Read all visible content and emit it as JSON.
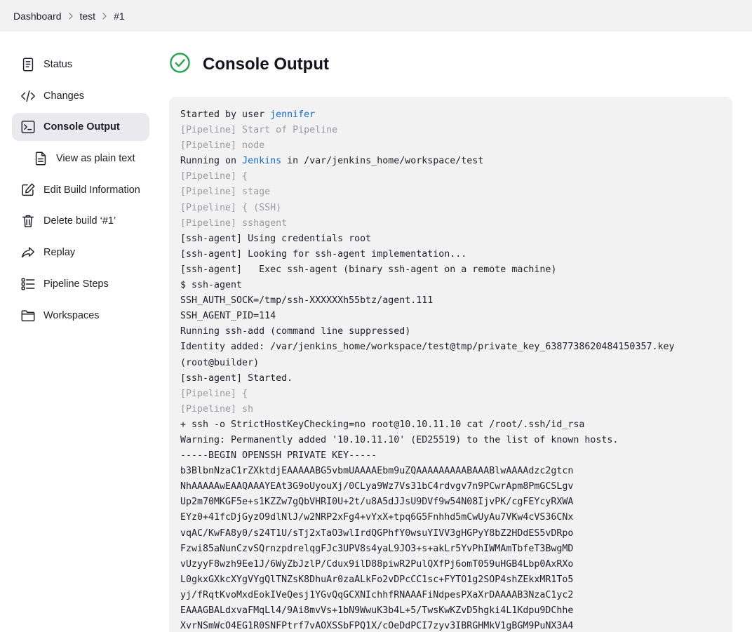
{
  "breadcrumb": [
    "Dashboard",
    "test",
    "#1"
  ],
  "sidebar": {
    "items": [
      {
        "label": "Status",
        "icon": "status-icon",
        "active": false
      },
      {
        "label": "Changes",
        "icon": "code-icon",
        "active": false
      },
      {
        "label": "Console Output",
        "icon": "terminal-icon",
        "active": true
      },
      {
        "label": "View as plain text",
        "icon": "document-icon",
        "active": false
      },
      {
        "label": "Edit Build Information",
        "icon": "edit-icon",
        "active": false
      },
      {
        "label": "Delete build ‘#1’",
        "icon": "trash-icon",
        "active": false
      },
      {
        "label": "Replay",
        "icon": "replay-icon",
        "active": false
      },
      {
        "label": "Pipeline Steps",
        "icon": "steps-icon",
        "active": false
      },
      {
        "label": "Workspaces",
        "icon": "folder-icon",
        "active": false
      }
    ]
  },
  "main": {
    "title": "Console Output",
    "status_icon": "success-check-icon",
    "status_color": "#1ea64b"
  },
  "console": {
    "started_prefix": "Started by user ",
    "started_user": "jennifer",
    "running_prefix": "Running on ",
    "running_node": "Jenkins",
    "running_suffix": " in /var/jenkins_home/workspace/test",
    "lines_a": [
      {
        "text": "[Pipeline] Start of Pipeline",
        "muted": true
      },
      {
        "text": "[Pipeline] node",
        "muted": true
      }
    ],
    "lines_b": [
      {
        "text": "[Pipeline] {",
        "muted": true
      },
      {
        "text": "[Pipeline] stage",
        "muted": true
      },
      {
        "text": "[Pipeline] { (SSH)",
        "muted": true
      },
      {
        "text": "[Pipeline] sshagent",
        "muted": true
      },
      {
        "text": "[ssh-agent] Using credentials root",
        "muted": false
      },
      {
        "text": "[ssh-agent] Looking for ssh-agent implementation...",
        "muted": false
      },
      {
        "text": "[ssh-agent]   Exec ssh-agent (binary ssh-agent on a remote machine)",
        "muted": false
      },
      {
        "text": "$ ssh-agent",
        "muted": false
      },
      {
        "text": "SSH_AUTH_SOCK=/tmp/ssh-XXXXXXh55btz/agent.111",
        "muted": false
      },
      {
        "text": "SSH_AGENT_PID=114",
        "muted": false
      },
      {
        "text": "Running ssh-add (command line suppressed)",
        "muted": false
      },
      {
        "text": "Identity added: /var/jenkins_home/workspace/test@tmp/private_key_6387738620484150357.key",
        "muted": false
      },
      {
        "text": "(root@builder)",
        "muted": false
      },
      {
        "text": "[ssh-agent] Started.",
        "muted": false
      },
      {
        "text": "[Pipeline] {",
        "muted": true
      },
      {
        "text": "[Pipeline] sh",
        "muted": true
      },
      {
        "text": "+ ssh -o StrictHostKeyChecking=no root@10.10.11.10 cat /root/.ssh/id_rsa",
        "muted": false
      },
      {
        "text": "Warning: Permanently added '10.10.11.10' (ED25519) to the list of known hosts.",
        "muted": false
      },
      {
        "text": "-----BEGIN OPENSSH PRIVATE KEY-----",
        "muted": false
      },
      {
        "text": "b3BlbnNzaC1rZXktdjEAAAAABG5vbmUAAAAEbm9uZQAAAAAAAAABAAABlwAAAAdzc2gtcn",
        "muted": false
      },
      {
        "text": "NhAAAAAwEAAQAAAYEAt3G9oUyouXj/0CLya9Wz7Vs31bC4rdvgv7n9PCwrApm8PmGCSLgv",
        "muted": false
      },
      {
        "text": "Up2m70MKGF5e+s1KZZw7gQbVHRI0U+2t/u8A5dJJsU9DVf9w54N08IjvPK/cgFEYcyRXWA",
        "muted": false
      },
      {
        "text": "EYz0+41fcDjGyzO9dlNlJ/w2NRP2xFg4+vYxX+tpq6G5Fnhhd5mCwUyAu7VKw4cVS36CNx",
        "muted": false
      },
      {
        "text": "vqAC/KwFA8y0/s24T1U/sTj2xTaO3wlIrdQGPhfY0wsuYIVV3gHGPyY8bZ2HDdES5vDRpo",
        "muted": false
      },
      {
        "text": "Fzwi85aNunCzvSQrnzpdrelqgFJc3UPV8s4yaL9JO3+s+akLr5YvPhIWMAmTbfeT3BwgMD",
        "muted": false
      },
      {
        "text": "vUzyyF8wzh9Ee1J/6WyZbJzlP/Cdux9ilD88piwR2PulQXfPj6omT059uHGB4Lbp0AxRXo",
        "muted": false
      },
      {
        "text": "L0gkxGXkcXYgVYgQlTNZsK8DhuAr0zaALkFo2vDPcCC1sc+FYTO1g2SOP4shZEkxMR1To5",
        "muted": false
      },
      {
        "text": "yj/fRqtKvoMxdEokIVeQesj1YGvQqGCXNIchhfRNAAAFiNdpesPXaXrDAAAAB3NzaC1yc2",
        "muted": false
      },
      {
        "text": "EAAAGBALdxvaFMqLl4/9Ai8mvVs+1bN9WwuK3b4L+5/TwsKwKZvD5hgki4L1Kdpu9DChhe",
        "muted": false
      },
      {
        "text": "XvrNSmWcO4EG1R0SNFPtrf7vAOXSSbFPQ1X/cOeDdPCI7zyv3IBRGHMkV1gBGM9PuNX3A4",
        "muted": false
      }
    ]
  }
}
